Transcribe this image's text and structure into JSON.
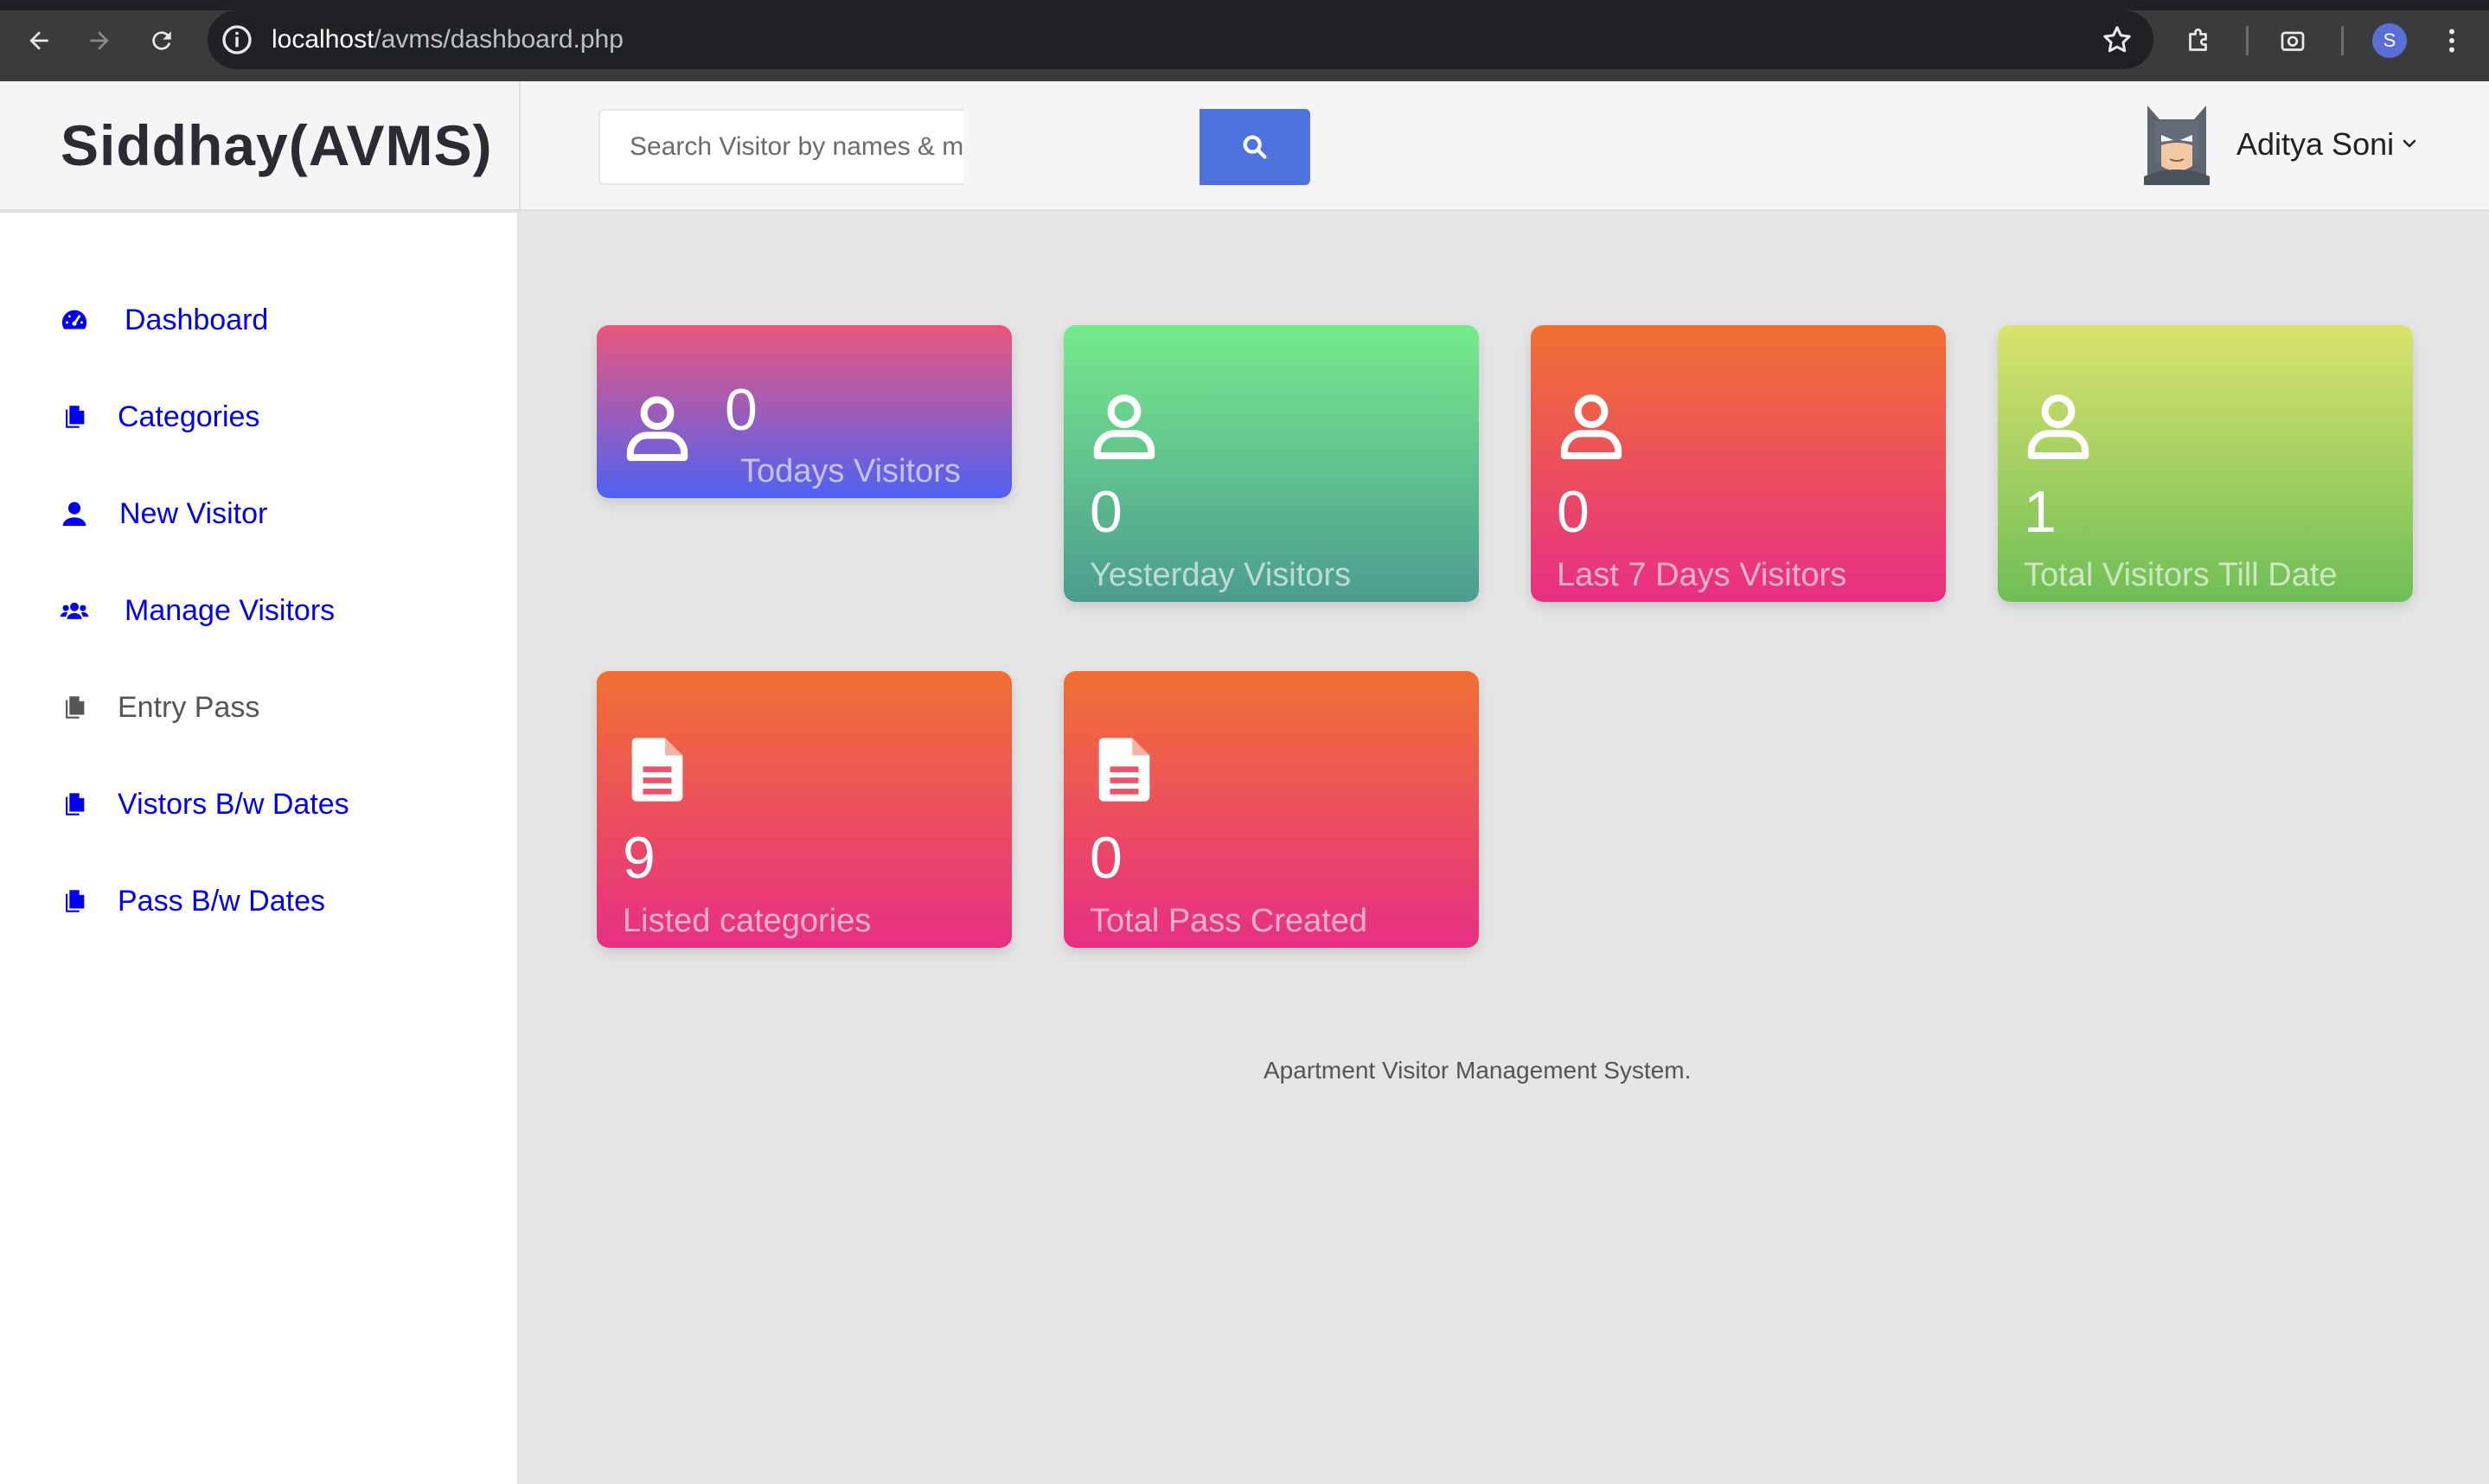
{
  "browser": {
    "url_host": "localhost",
    "url_path": "/avms/dashboard.php",
    "profile_initial": "S"
  },
  "app": {
    "brand": "Siddhay(AVMS)"
  },
  "search": {
    "placeholder": "Search Visitor by names & mobile number..."
  },
  "user": {
    "name": "Aditya Soni"
  },
  "sidebar": {
    "items": [
      {
        "label": "Dashboard",
        "icon": "tachometer-icon"
      },
      {
        "label": "Categories",
        "icon": "files-icon"
      },
      {
        "label": "New Visitor",
        "icon": "user-icon"
      },
      {
        "label": "Manage Visitors",
        "icon": "users-icon"
      },
      {
        "label": "Entry Pass",
        "icon": "files-icon"
      },
      {
        "label": "Vistors B/w Dates",
        "icon": "files-icon"
      },
      {
        "label": "Pass B/w Dates",
        "icon": "files-icon"
      }
    ]
  },
  "cards": [
    {
      "value": "0",
      "label": "Todays Visitors",
      "icon": "user-outline-icon",
      "color": "#4f62f2"
    },
    {
      "value": "0",
      "label": "Yesterday Visitors",
      "icon": "user-outline-icon",
      "color": "#4c9c90"
    },
    {
      "value": "0",
      "label": "Last 7 Days Visitors",
      "icon": "user-outline-icon",
      "color": "#e72f84"
    },
    {
      "value": "1",
      "label": "Total Visitors Till Date",
      "icon": "user-outline-icon",
      "color": "#6fbe57"
    },
    {
      "value": "9",
      "label": "Listed categories",
      "icon": "document-icon",
      "color": "#e72f84"
    },
    {
      "value": "0",
      "label": "Total Pass Created",
      "icon": "document-icon",
      "color": "#e72f84"
    }
  ],
  "footer": {
    "text": "Apartment Visitor Management System."
  }
}
